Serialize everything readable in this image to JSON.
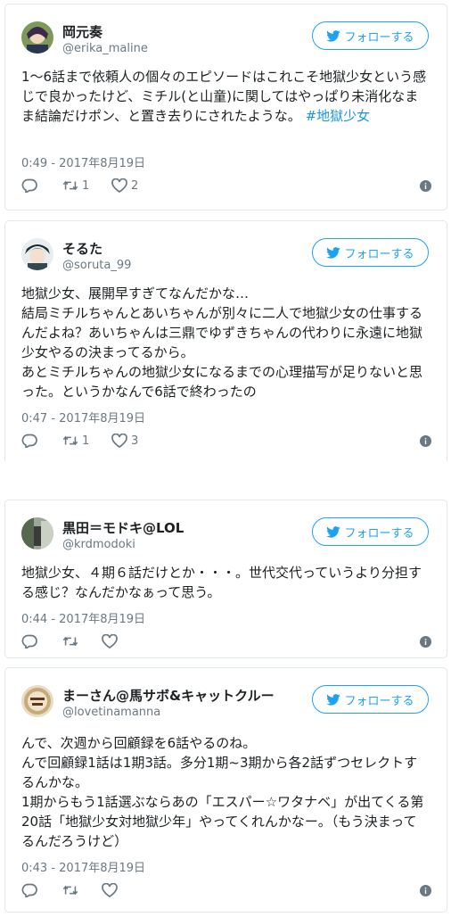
{
  "follow_label": "フォローする",
  "tweets": [
    {
      "name": "岡元奏",
      "handle": "@erika_maline",
      "text": "1〜6話まで依頼人の個々のエピソードはこれこそ地獄少女という感じで良かったけど、ミチル(と山童)に関してはやっぱり未消化なまま結論だけポン、と置き去りにされたような。",
      "hashtag": "#地獄少女",
      "time": "0:49 - 2017年8月19日",
      "retweets": "1",
      "likes": "2"
    },
    {
      "name": "そるた",
      "handle": "@soruta_99",
      "text": "地獄少女、展開早すぎてなんだかな…\n結局ミチルちゃんとあいちゃんが別々に二人で地獄少女の仕事するんだよね？あいちゃんは三鼎でゆずきちゃんの代わりに永遠に地獄少女やるの決まってるから。\nあとミチルちゃんの地獄少女になるまでの心理描写が足りないと思った。というかなんで6話で終わったの",
      "hashtag": "",
      "time": "0:47 - 2017年8月19日",
      "retweets": "1",
      "likes": "3"
    },
    {
      "name": "黒田＝モドキ@LOL",
      "handle": "@krdmodoki",
      "text": "地獄少女、４期６話だけとか・・・。世代交代っていうより分担する感じ？なんだかなぁって思う。",
      "hashtag": "",
      "time": "0:44 - 2017年8月19日",
      "retweets": "",
      "likes": ""
    },
    {
      "name": "まーさん@馬サボ&キャットクルー",
      "handle": "@lovetinamanna",
      "text": "んで、次週から回顧録を6話やるのね。\nんで回顧録1話は1期3話。多分1期~3期から各2話ずつセレクトするんかな。\n1期からもう1話選ぶならあの「エスパー☆ワタナベ」が出てくる第20話「地獄少女対地獄少年」やってくれんかなー。（もう決まってるんだろうけど）",
      "hashtag": "",
      "time": "0:43 - 2017年8月19日",
      "retweets": "",
      "likes": ""
    }
  ],
  "colors": {
    "accent": "#1da1f2",
    "hashtag": "#1b95e0",
    "muted": "#697882",
    "border": "#e1e8ed"
  }
}
